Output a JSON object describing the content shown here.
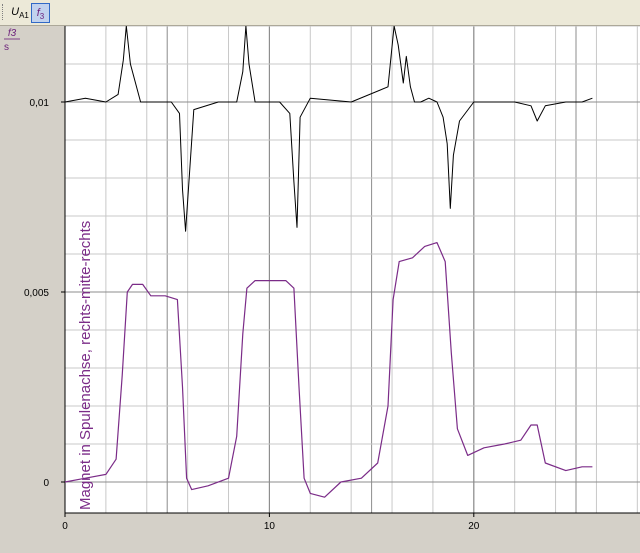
{
  "toolbar": {
    "channel1": "U",
    "channel1_sub": "A1",
    "channel2": "f",
    "channel2_sub": "3"
  },
  "axis": {
    "unit_top": "f3",
    "unit_bottom": "s"
  },
  "annotation": "Magnet in Spulenachse, rechts-mitte-rechts",
  "colors": {
    "signal": "#000000",
    "integral": "#7b2c88",
    "grid_minor": "#c8c8c8",
    "grid_major": "#8c8c8c"
  },
  "chart_data": {
    "type": "line",
    "xlim": [
      0,
      28
    ],
    "ylim": [
      -0.0008,
      0.0122
    ],
    "xticks": [
      "0",
      "10",
      "20"
    ],
    "xtick_values": [
      0,
      10,
      20
    ],
    "yticks": [
      "0",
      "0,005",
      "0,01"
    ],
    "ytick_values": [
      0,
      0.005,
      0.01
    ],
    "series": [
      {
        "color": "#000000",
        "x": [
          0,
          1,
          2,
          2.6,
          2.85,
          3.0,
          3.2,
          3.7,
          4.5,
          5.2,
          5.6,
          5.75,
          5.9,
          6.3,
          7.5,
          8.4,
          8.7,
          8.85,
          9.0,
          9.3,
          10.5,
          11.0,
          11.2,
          11.35,
          11.5,
          12.0,
          14.0,
          15.8,
          16.1,
          16.3,
          16.55,
          16.7,
          16.9,
          17.1,
          17.4,
          17.8,
          18.2,
          18.5,
          18.7,
          18.85,
          19.0,
          19.3,
          20.0,
          21.0,
          22.0,
          22.8,
          23.1,
          23.5,
          24.5,
          25.3,
          25.8
        ],
        "y": [
          0.01,
          0.0101,
          0.01,
          0.0102,
          0.0111,
          0.0125,
          0.011,
          0.01,
          0.01,
          0.01,
          0.0097,
          0.0077,
          0.0066,
          0.0098,
          0.01,
          0.01,
          0.0108,
          0.0125,
          0.011,
          0.01,
          0.01,
          0.0097,
          0.0079,
          0.0067,
          0.0096,
          0.0101,
          0.01,
          0.0104,
          0.0125,
          0.0115,
          0.0105,
          0.0112,
          0.0104,
          0.01,
          0.01,
          0.0101,
          0.01,
          0.0096,
          0.0089,
          0.0072,
          0.0086,
          0.0095,
          0.01,
          0.01,
          0.01,
          0.0099,
          0.0095,
          0.0099,
          0.01,
          0.01,
          0.0101
        ]
      },
      {
        "color": "#7b2c88",
        "x": [
          0,
          1,
          2,
          2.5,
          2.8,
          3.05,
          3.3,
          3.8,
          4.2,
          4.9,
          5.5,
          5.75,
          5.95,
          6.2,
          7.0,
          8.0,
          8.4,
          8.7,
          8.9,
          9.3,
          10.0,
          10.8,
          11.2,
          11.45,
          11.7,
          12.0,
          12.7,
          13.5,
          14.5,
          15.3,
          15.8,
          16.05,
          16.35,
          17.0,
          17.6,
          18.2,
          18.6,
          18.9,
          19.2,
          19.7,
          20.5,
          21.5,
          22.3,
          22.8,
          23.1,
          23.5,
          24.5,
          25.3,
          25.8
        ],
        "y": [
          0,
          0.0001,
          0.0002,
          0.0006,
          0.0028,
          0.005,
          0.0052,
          0.0052,
          0.0049,
          0.0049,
          0.0048,
          0.0025,
          0.0001,
          -0.0002,
          -0.0001,
          0.0001,
          0.0012,
          0.0039,
          0.0051,
          0.0053,
          0.0053,
          0.0053,
          0.0051,
          0.0025,
          0.0001,
          -0.0003,
          -0.0004,
          0.0,
          0.0001,
          0.0005,
          0.002,
          0.0048,
          0.0058,
          0.0059,
          0.0062,
          0.0063,
          0.0058,
          0.0034,
          0.0014,
          0.0007,
          0.0009,
          0.001,
          0.0011,
          0.0015,
          0.0015,
          0.0005,
          0.0003,
          0.0004,
          0.0004
        ]
      }
    ]
  }
}
